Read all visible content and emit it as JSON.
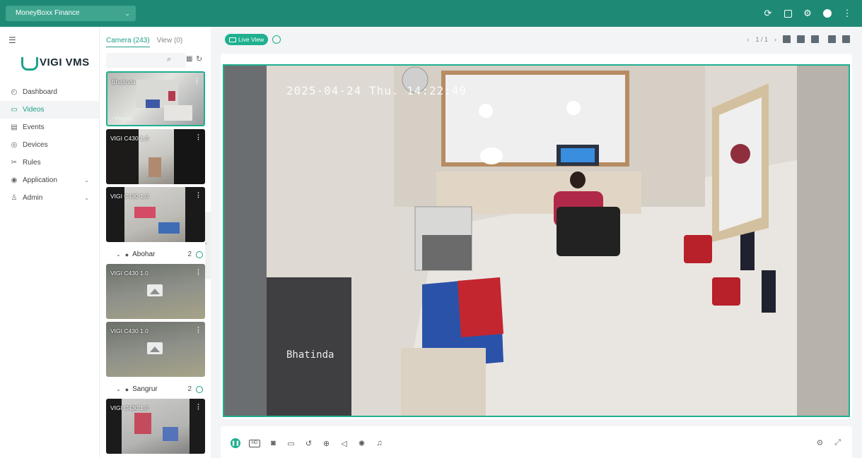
{
  "topbar": {
    "org_name": "MoneyBoxx Finance",
    "icons": [
      "refresh-icon",
      "download-icon",
      "settings-icon",
      "user-avatar-icon",
      "more-icon"
    ]
  },
  "sidebar": {
    "brand": "VIGI VMS",
    "items": [
      {
        "label": "Dashboard",
        "icon": "dashboard-icon"
      },
      {
        "label": "Videos",
        "icon": "video-icon",
        "active": true
      },
      {
        "label": "Events",
        "icon": "events-icon"
      },
      {
        "label": "Devices",
        "icon": "devices-icon"
      },
      {
        "label": "Rules",
        "icon": "rules-icon"
      },
      {
        "label": "Application",
        "icon": "application-icon",
        "expandable": true
      },
      {
        "label": "Admin",
        "icon": "admin-icon",
        "expandable": true
      }
    ]
  },
  "panel": {
    "tabs": [
      "Camera (243)",
      "View (0)"
    ],
    "search_value": "",
    "cameras": [
      {
        "name": "Bhatinda",
        "status": "Playing"
      },
      {
        "name": "VIGI C430 1.0"
      },
      {
        "name": "VIGI C430 1.0"
      }
    ],
    "groups": [
      {
        "name": "Abohar",
        "count": "2",
        "cameras": [
          {
            "name": "VIGI C430 1.0"
          },
          {
            "name": "VIGI C430 1.0"
          }
        ]
      },
      {
        "name": "Sangrur",
        "count": "2",
        "cameras": [
          {
            "name": "VIGI C430 1.0"
          }
        ]
      }
    ]
  },
  "main": {
    "live_view_label": "Live View",
    "pager": "1 / 1",
    "osd_timestamp": "2025-04-24 Thu. 14:22:49",
    "osd_name": "Bhatinda"
  },
  "colors": {
    "brand_teal": "#1e8a76",
    "accent": "#1eb08f"
  }
}
